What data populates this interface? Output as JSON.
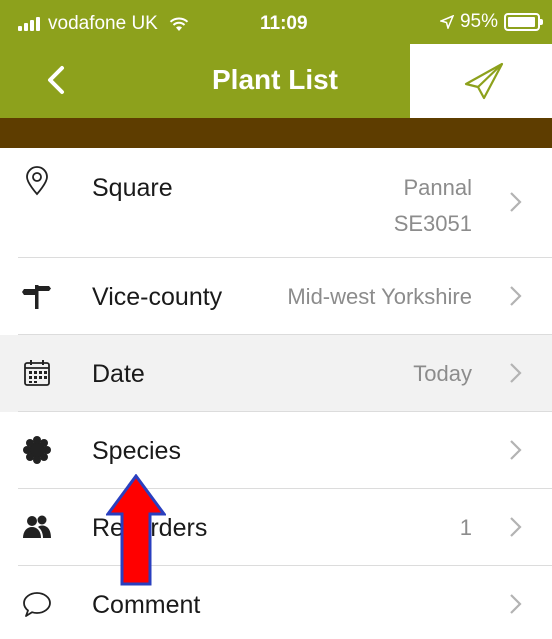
{
  "status": {
    "carrier": "vodafone UK",
    "time": "11:09",
    "battery": "95%",
    "battery_level": 0.95
  },
  "nav": {
    "title": "Plant List",
    "back_icon": "chevron-left-icon",
    "send_icon": "paper-plane-icon"
  },
  "colors": {
    "brand_green": "#8da11c",
    "brown_bar": "#5e3d00",
    "annotation_arrow": "#ff0000"
  },
  "rows": [
    {
      "label": "Square",
      "value_line1": "Pannal",
      "value_line2": "SE3051",
      "icon": "map-pin-icon"
    },
    {
      "label": "Vice-county",
      "value": "Mid-west Yorkshire",
      "icon": "signpost-icon"
    },
    {
      "label": "Date",
      "value": "Today",
      "icon": "calendar-icon"
    },
    {
      "label": "Species",
      "value": "",
      "icon": "flower-icon"
    },
    {
      "label": "Recorders",
      "value": "1",
      "icon": "people-icon"
    },
    {
      "label": "Comment",
      "value": "",
      "icon": "speech-bubble-icon"
    }
  ]
}
